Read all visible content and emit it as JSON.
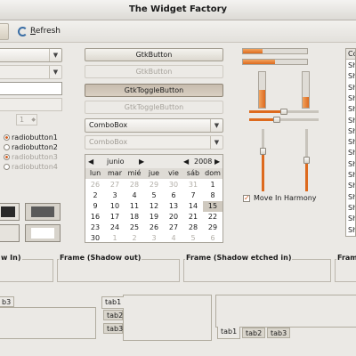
{
  "window": {
    "title": "The Widget Factory"
  },
  "toolbar": {
    "refresh_label": "Refresh",
    "refresh_mnemonic": "R"
  },
  "left_column": {
    "spin_value": "1",
    "radios": [
      {
        "label": "radiobutton1",
        "checked": true,
        "disabled": false
      },
      {
        "label": "radiobutton2",
        "checked": false,
        "disabled": false
      },
      {
        "label": "radiobutton3",
        "checked": true,
        "disabled": true
      },
      {
        "label": "radiobutton4",
        "checked": false,
        "disabled": true
      }
    ]
  },
  "buttons": {
    "gtk_button": "GtkButton",
    "gtk_button_disabled": "GtkButton",
    "toggle_button": "GtkToggleButton",
    "toggle_button_disabled": "GtkToggleButton"
  },
  "combos": {
    "combobox": "ComboBox",
    "combobox_disabled": "ComboBox"
  },
  "calendar": {
    "month": "junio",
    "year": "2008",
    "weekdays": [
      "lun",
      "mar",
      "mié",
      "jue",
      "vie",
      "sáb",
      "dom"
    ],
    "weeks": [
      [
        "26",
        "27",
        "28",
        "29",
        "30",
        "31",
        "1"
      ],
      [
        "2",
        "3",
        "4",
        "5",
        "6",
        "7",
        "8"
      ],
      [
        "9",
        "10",
        "11",
        "12",
        "13",
        "14",
        "15"
      ],
      [
        "16",
        "17",
        "18",
        "19",
        "20",
        "21",
        "22"
      ],
      [
        "23",
        "24",
        "25",
        "26",
        "27",
        "28",
        "29"
      ],
      [
        "30",
        "1",
        "2",
        "3",
        "4",
        "5",
        "6"
      ]
    ],
    "selected_day": "15"
  },
  "progress": {
    "hbar_1": 0.3,
    "hbar_2": 0.5,
    "vbar_1": 0.5,
    "vbar_2": 0.3
  },
  "scales": {
    "hscale_1": 0.5,
    "hscale_2": 0.4,
    "vscale_1": 0.35,
    "vscale_2": 0.5
  },
  "move_in_harmony": {
    "label": "Move In Harmony",
    "checked": true
  },
  "list": {
    "header": "Co",
    "rows": [
      "Sh",
      "Sh",
      "Sh",
      "Sh",
      "Sh",
      "Sh",
      "Sh",
      "Sh",
      "Sh",
      "Sh",
      "Sh",
      "Sh",
      "Sh",
      "Sh",
      "Sh",
      "Sh"
    ]
  },
  "frames": {
    "shadow_in": "w In)",
    "shadow_out": "Frame (Shadow out)",
    "shadow_etched_in": "Frame (Shadow etched in)",
    "shadow_etched_out": "Fram"
  },
  "notebooks": {
    "nb1_tab": "b3",
    "nb2_tabs": [
      "tab1",
      "tab2",
      "tab3"
    ],
    "nb3_tabs": [
      "tab1",
      "tab2",
      "tab3"
    ]
  },
  "colors": {
    "accent": "#dd6a1e",
    "window_bg": "#ebe9e5",
    "desktop_bg": "#3b5e2b"
  }
}
